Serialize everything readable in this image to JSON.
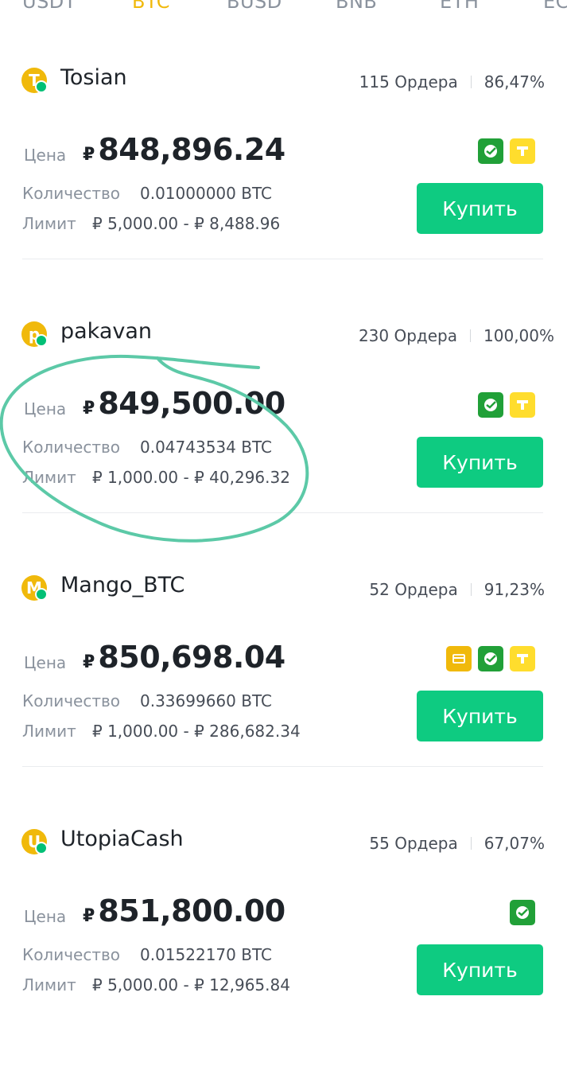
{
  "tabs": [
    {
      "label": "USDT",
      "active": false
    },
    {
      "label": "BTC",
      "active": true
    },
    {
      "label": "BUSD",
      "active": false
    },
    {
      "label": "BNB",
      "active": false
    },
    {
      "label": "ETH",
      "active": false
    },
    {
      "label": "EC",
      "active": false
    }
  ],
  "labels": {
    "price": "Цена",
    "quantity": "Количество",
    "limit": "Лимит",
    "buy": "Купить"
  },
  "offers": [
    {
      "avatar": "T",
      "name": "Tosian",
      "orders": "115 Ордера",
      "completion": "86,47%",
      "currency": "₽",
      "price": "848,896.24",
      "quantity": "0.01000000 BTC",
      "limit": "₽ 5,000.00 - ₽ 8,488.96",
      "payments": [
        "sberbank-icon",
        "tinkoff-icon"
      ]
    },
    {
      "avatar": "p",
      "name": "pakavan",
      "orders": "230 Ордера",
      "completion": "100,00%",
      "currency": "₽",
      "price": "849,500.00",
      "quantity": "0.04743534 BTC",
      "limit": "₽ 1,000.00 - ₽ 40,296.32",
      "payments": [
        "sberbank-icon",
        "tinkoff-icon"
      ]
    },
    {
      "avatar": "M",
      "name": "Mango_BTC",
      "orders": "52 Ордера",
      "completion": "91,23%",
      "currency": "₽",
      "price": "850,698.04",
      "quantity": "0.33699660 BTC",
      "limit": "₽ 1,000.00 - ₽ 286,682.34",
      "payments": [
        "bank-card-icon",
        "sberbank-icon",
        "tinkoff-icon"
      ]
    },
    {
      "avatar": "U",
      "name": "UtopiaCash",
      "orders": "55 Ордера",
      "completion": "67,07%",
      "currency": "₽",
      "price": "851,800.00",
      "quantity": "0.01522170 BTC",
      "limit": "₽ 5,000.00 - ₽ 12,965.84",
      "payments": [
        "sberbank-icon"
      ]
    }
  ],
  "colors": {
    "accent": "#f0b90b",
    "buy": "#0ecb81",
    "highlight_circle": "#5cc9a7"
  }
}
